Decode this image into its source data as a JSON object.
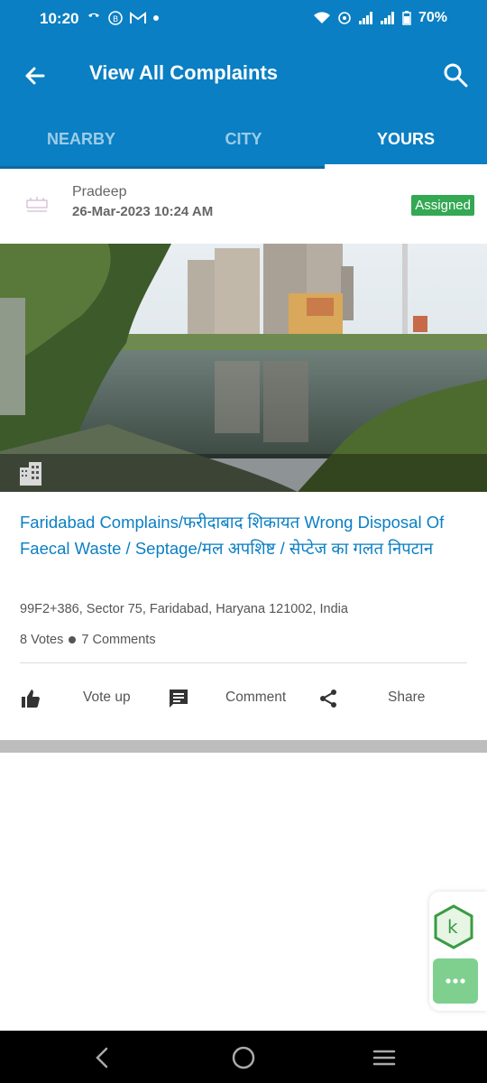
{
  "status": {
    "time": "10:20",
    "battery": "70%"
  },
  "appbar": {
    "title": "View All Complaints",
    "back_icon": "arrow-left-icon",
    "search_icon": "search-icon"
  },
  "tabs": [
    {
      "label": "NEARBY",
      "active": false
    },
    {
      "label": "CITY",
      "active": false
    },
    {
      "label": "YOURS",
      "active": true
    }
  ],
  "complaint": {
    "author": "Pradeep",
    "date": "26-Mar-2023 10:24 AM",
    "status": "Assigned",
    "title": "Faridabad Complains/फरीदाबाद शिकायत   Wrong Disposal Of Faecal Waste / Septage/मल अपशिष्ट / सेप्टेज का गलत निपटान",
    "address": "99F2+386, Sector 75, Faridabad, Haryana 121002, India",
    "votes": "8 Votes",
    "comments": "7 Comments",
    "actions": {
      "vote": "Vote up",
      "comment": "Comment",
      "share": "Share"
    }
  },
  "colors": {
    "primary": "#0a7fc3",
    "badge": "#34a853",
    "fab": "#7fd08f"
  }
}
